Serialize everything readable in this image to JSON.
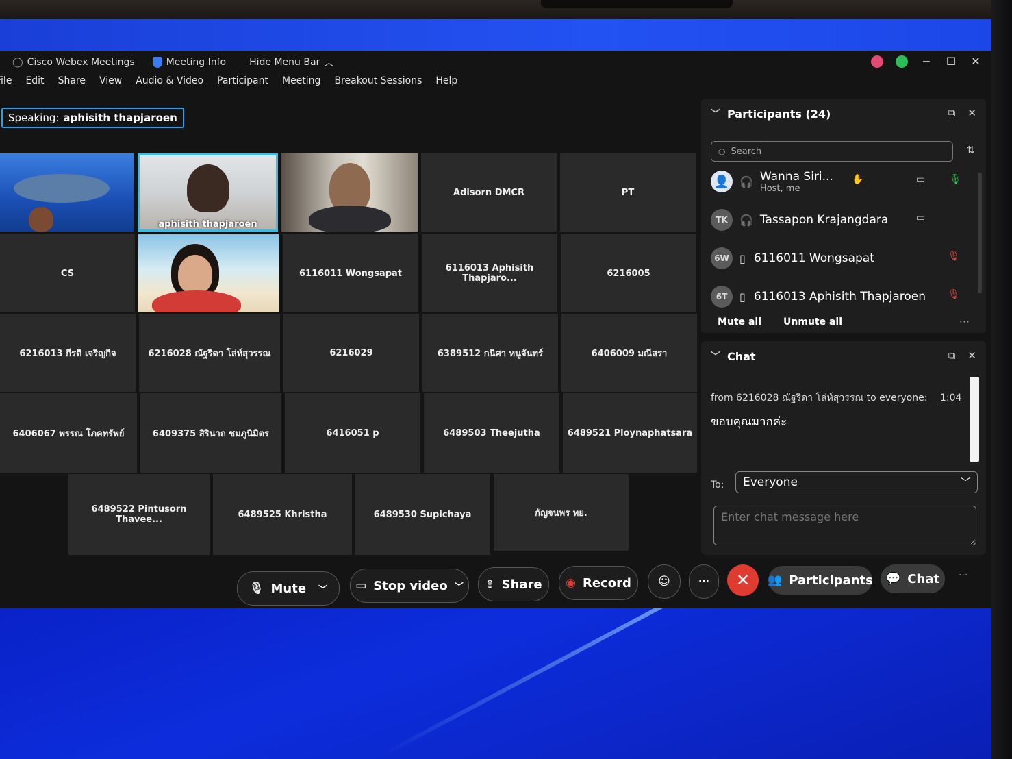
{
  "window": {
    "app_title": "Cisco Webex Meetings",
    "meeting_info": "Meeting Info",
    "hide_menu_bar": "Hide Menu Bar"
  },
  "menu": [
    "File",
    "Edit",
    "Share",
    "View",
    "Audio & Video",
    "Participant",
    "Meeting",
    "Breakout Sessions",
    "Help"
  ],
  "speaking": {
    "label": "Speaking:",
    "name": "aphisith thapjaroen"
  },
  "video_tiles": [
    {
      "label": ""
    },
    {
      "label": "aphisith thapjaroen"
    },
    {
      "label": ""
    },
    {
      "label": "Adisorn DMCR"
    },
    {
      "label": "PT"
    },
    {
      "label": "CS"
    },
    {
      "label": ""
    },
    {
      "label": "6116011 Wongsapat"
    },
    {
      "label": "6116013 Aphisith Thapjaro..."
    },
    {
      "label": "6216005"
    },
    {
      "label": "6216013 กีรติ เจริญกิจ"
    },
    {
      "label": "6216028 ณัฐริดา โล่ห์สุวรรณ"
    },
    {
      "label": "6216029"
    },
    {
      "label": "6389512 กนิศา หนูจันทร์"
    },
    {
      "label": "6406009 มณีสรา"
    },
    {
      "label": "6406067 พรรณ โภคทรัพย์"
    },
    {
      "label": "6409375 สิรินาถ ชมภูนิมิตร"
    },
    {
      "label": "6416051 p"
    },
    {
      "label": "6489503 Theejutha"
    },
    {
      "label": "6489521 Ploynaphatsara"
    },
    {
      "label": "6489522 Pintusorn Thavee..."
    },
    {
      "label": "6489525 Khristha"
    },
    {
      "label": "6489530 Supichaya"
    },
    {
      "label": "กัญจนพร ทย."
    }
  ],
  "participants": {
    "title": "Participants (24)",
    "search_placeholder": "Search",
    "items": [
      {
        "initials": "",
        "name": "Wanna Siri...",
        "sub": "Host, me"
      },
      {
        "initials": "TK",
        "name": "Tassapon Krajangdara",
        "sub": ""
      },
      {
        "initials": "6W",
        "name": "6116011 Wongsapat",
        "sub": ""
      },
      {
        "initials": "6T",
        "name": "6116013 Aphisith Thapjaroen",
        "sub": ""
      }
    ],
    "mute_all": "Mute all",
    "unmute_all": "Unmute all"
  },
  "chat": {
    "title": "Chat",
    "from": "from 6216028 ณัฐริดา โล่ห์สุวรรณ to everyone:",
    "time": "1:04",
    "message": "ขอบคุณมากค่ะ",
    "to_label": "To:",
    "to_value": "Everyone",
    "input_placeholder": "Enter chat message here"
  },
  "controls": {
    "mute": "Mute",
    "stop_video": "Stop video",
    "share": "Share",
    "record": "Record",
    "more": "···",
    "participants": "Participants",
    "chat": "Chat"
  },
  "colors": {
    "accent": "#2d9df0",
    "end_call": "#e03b30",
    "mic_on": "#2ecc55",
    "mic_off": "#e0453a",
    "desktop_blue": "#1c47e8"
  }
}
